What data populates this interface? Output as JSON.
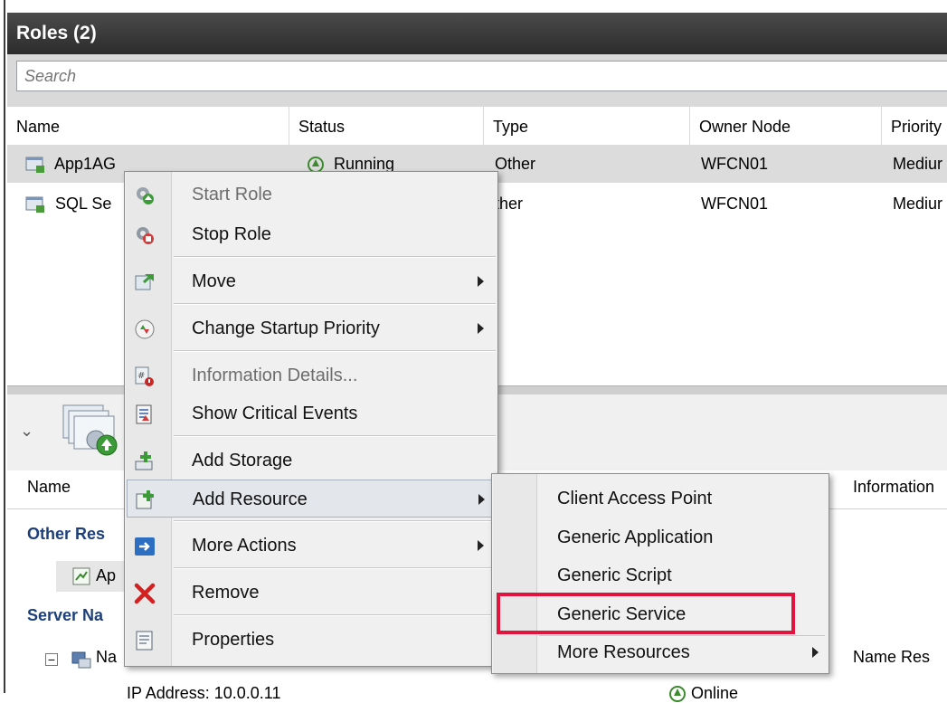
{
  "roles": {
    "title": "Roles (2)",
    "search_placeholder": "Search",
    "columns": [
      "Name",
      "Status",
      "Type",
      "Owner Node",
      "Priority"
    ],
    "rows": [
      {
        "name": "App1AG",
        "status": "Running",
        "type": "Other",
        "owner": "WFCN01",
        "priority": "Mediur"
      },
      {
        "name": "SQL Se",
        "status": "",
        "type": "ther",
        "owner": "WFCN01",
        "priority": "Mediur"
      }
    ]
  },
  "details": {
    "columns": [
      "Name",
      "Information"
    ],
    "group_other": "Other Res",
    "item_other": "Ap",
    "group_server": "Server Na",
    "item_name": "Na",
    "item_name_info": "Name Res",
    "ip_fragment": "IP Address: 10.0.0.11",
    "ip_status": "Online"
  },
  "context_menu": {
    "items": [
      {
        "label": "Start Role",
        "icon": "start-role-icon",
        "disabled": true
      },
      {
        "label": "Stop Role",
        "icon": "stop-role-icon"
      },
      {
        "label": "Move",
        "icon": "move-icon",
        "submenu": true
      },
      {
        "label": "Change Startup Priority",
        "icon": "priority-icon",
        "submenu": true
      },
      {
        "label": "Information Details...",
        "icon": "info-details-icon",
        "disabled": true
      },
      {
        "label": "Show Critical Events",
        "icon": "critical-events-icon"
      },
      {
        "label": "Add Storage",
        "icon": "add-storage-icon"
      },
      {
        "label": "Add Resource",
        "icon": "add-resource-icon",
        "submenu": true
      },
      {
        "label": "More Actions",
        "icon": "more-actions-icon",
        "submenu": true
      },
      {
        "label": "Remove",
        "icon": "remove-icon"
      },
      {
        "label": "Properties",
        "icon": "properties-icon"
      }
    ]
  },
  "submenu": {
    "items": [
      {
        "label": "Client Access Point"
      },
      {
        "label": "Generic Application"
      },
      {
        "label": "Generic Script"
      },
      {
        "label": "Generic Service"
      },
      {
        "label": "More Resources",
        "submenu": true
      }
    ]
  },
  "colors": {
    "title_bar": "#2c2c2c",
    "highlight": "#e0143c",
    "group_text": "#1d3f7a",
    "status_green": "#3c8a2e"
  }
}
